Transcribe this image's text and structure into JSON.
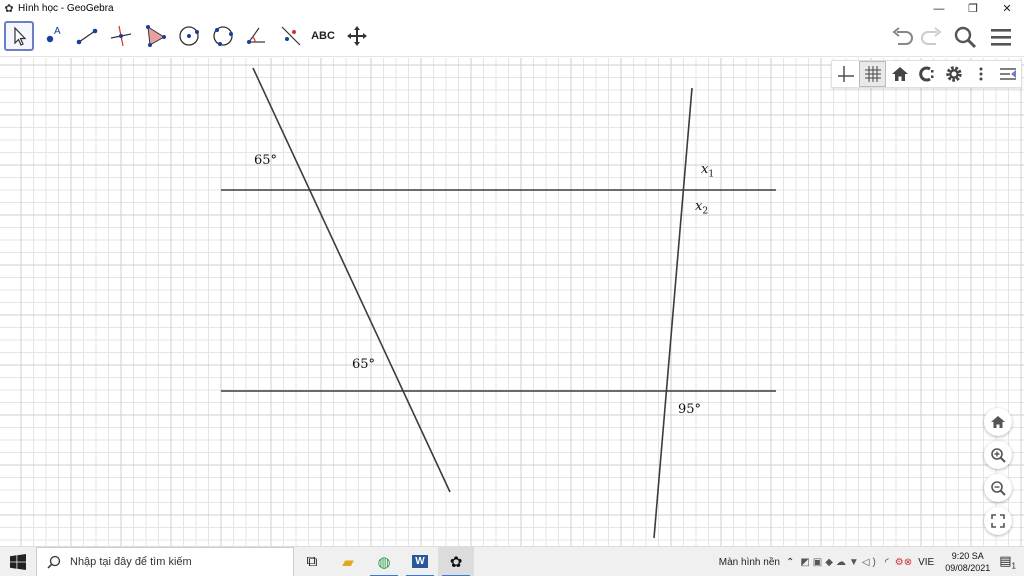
{
  "window": {
    "title": "Hình học - GeoGebra",
    "controls": [
      "minimize",
      "restore",
      "close"
    ]
  },
  "toolbar": {
    "tools": [
      {
        "name": "move-tool-icon",
        "active": true
      },
      {
        "name": "point-tool-icon"
      },
      {
        "name": "segment-tool-icon"
      },
      {
        "name": "perpendicular-line-tool-icon"
      },
      {
        "name": "polygon-tool-icon"
      },
      {
        "name": "circle-center-point-tool-icon"
      },
      {
        "name": "circle-three-points-tool-icon"
      },
      {
        "name": "angle-tool-icon"
      },
      {
        "name": "reflect-tool-icon"
      },
      {
        "name": "text-tool",
        "label": "ABC"
      },
      {
        "name": "move-graphics-view-tool-icon"
      }
    ],
    "right_icons": [
      "undo-icon",
      "redo-icon",
      "search-icon",
      "menu-icon"
    ]
  },
  "style_bar": {
    "icons": [
      "axes-icon",
      "grid-icon",
      "home-icon",
      "point-capturing-icon",
      "settings-icon",
      "more-icon",
      "toggle-style-bar-icon"
    ],
    "grid_on": true
  },
  "graphics": {
    "grid": true,
    "labels": {
      "angle_top_left": "65°",
      "angle_bottom_left": "65°",
      "angle_bottom_right": "95°",
      "x1_var": "x",
      "x1_sub": "1",
      "x2_var": "x",
      "x2_sub": "2"
    },
    "zoom_buttons": [
      "home-view-icon",
      "zoom-in-icon",
      "zoom-out-icon",
      "fullscreen-icon"
    ]
  },
  "taskbar": {
    "search_placeholder": "Nhập tại đây để tìm kiếm",
    "apps": [
      "task-view-icon",
      "file-explorer-icon",
      "chrome-icon",
      "word-icon",
      "geogebra-icon"
    ],
    "desktop_label": "Màn hình nền",
    "language": "VIE",
    "time": "9:20 SA",
    "date": "09/08/2021",
    "notification_count": "1"
  },
  "colors": {
    "line": "#3c3c3c",
    "grid_minor": "#e5e5e5",
    "grid_major": "#cfcfcf",
    "active_tool_border": "#6b7ec7"
  }
}
